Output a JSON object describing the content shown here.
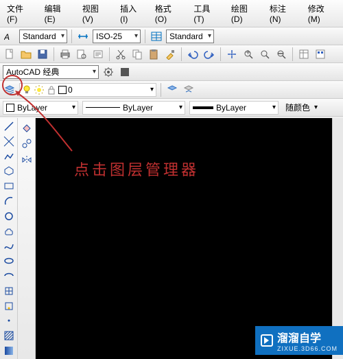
{
  "menu": {
    "file": "文件(F)",
    "edit": "编辑(E)",
    "view": "视图(V)",
    "insert": "插入(I)",
    "format": "格式(O)",
    "tools": "工具(T)",
    "draw": "绘图(D)",
    "annotate": "标注(N)",
    "modify": "修改(M)"
  },
  "style": {
    "text": "Standard",
    "dim": "ISO-25",
    "table": "Standard"
  },
  "workspace": "AutoCAD 经典",
  "layer": {
    "current": "0",
    "props": {
      "on": true,
      "thaw": true,
      "color": "#ffff00"
    }
  },
  "props": {
    "color": "ByLayer",
    "linetype": "ByLayer",
    "lineweight": "ByLayer",
    "followcolor": "随颜色"
  },
  "annotation": "点击图层管理器",
  "watermark": {
    "brand": "溜溜自学",
    "url": "ZIXUE.3D66.COM"
  }
}
